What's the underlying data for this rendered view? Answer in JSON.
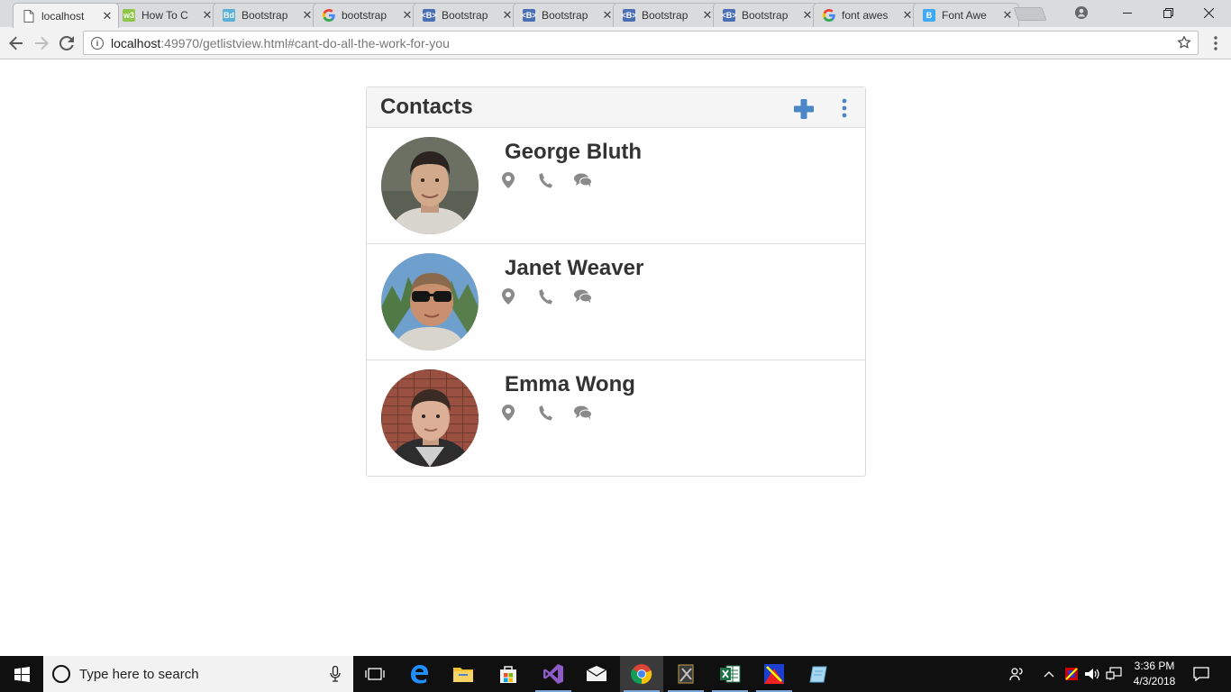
{
  "browser": {
    "tabs": [
      {
        "title": "localhost",
        "favicon": "page-icon",
        "active": true
      },
      {
        "title": "How To C",
        "favicon": "w3schools-icon"
      },
      {
        "title": "Bootstrap",
        "favicon": "bootsnipp-icon"
      },
      {
        "title": "bootstrap",
        "favicon": "google-icon"
      },
      {
        "title": "Bootstrap",
        "favicon": "bootstrap-b-icon"
      },
      {
        "title": "Bootstrap",
        "favicon": "bootstrap-b-icon"
      },
      {
        "title": "Bootstrap",
        "favicon": "bootstrap-b-icon"
      },
      {
        "title": "Bootstrap",
        "favicon": "bootstrap-b-icon"
      },
      {
        "title": "font awes",
        "favicon": "google-icon"
      },
      {
        "title": "Font Awe",
        "favicon": "bootstrap-b-icon-light"
      }
    ],
    "address": {
      "host": "localhost",
      "path": ":49970/getlistview.html#cant-do-all-the-work-for-you"
    }
  },
  "panel": {
    "title": "Contacts",
    "accent": "#4a86c8",
    "icon_color": "#8a8a8a"
  },
  "contacts": [
    {
      "name": "George Bluth"
    },
    {
      "name": "Janet Weaver"
    },
    {
      "name": "Emma Wong"
    }
  ],
  "taskbar": {
    "search_placeholder": "Type here to search",
    "time": "3:36 PM",
    "date": "4/3/2018",
    "apps": [
      "task-view-icon",
      "edge-icon",
      "file-explorer-icon",
      "store-icon",
      "visual-studio-icon",
      "mail-icon",
      "chrome-icon",
      "tools-icon",
      "excel-icon",
      "paint-icon",
      "notes-icon"
    ]
  }
}
